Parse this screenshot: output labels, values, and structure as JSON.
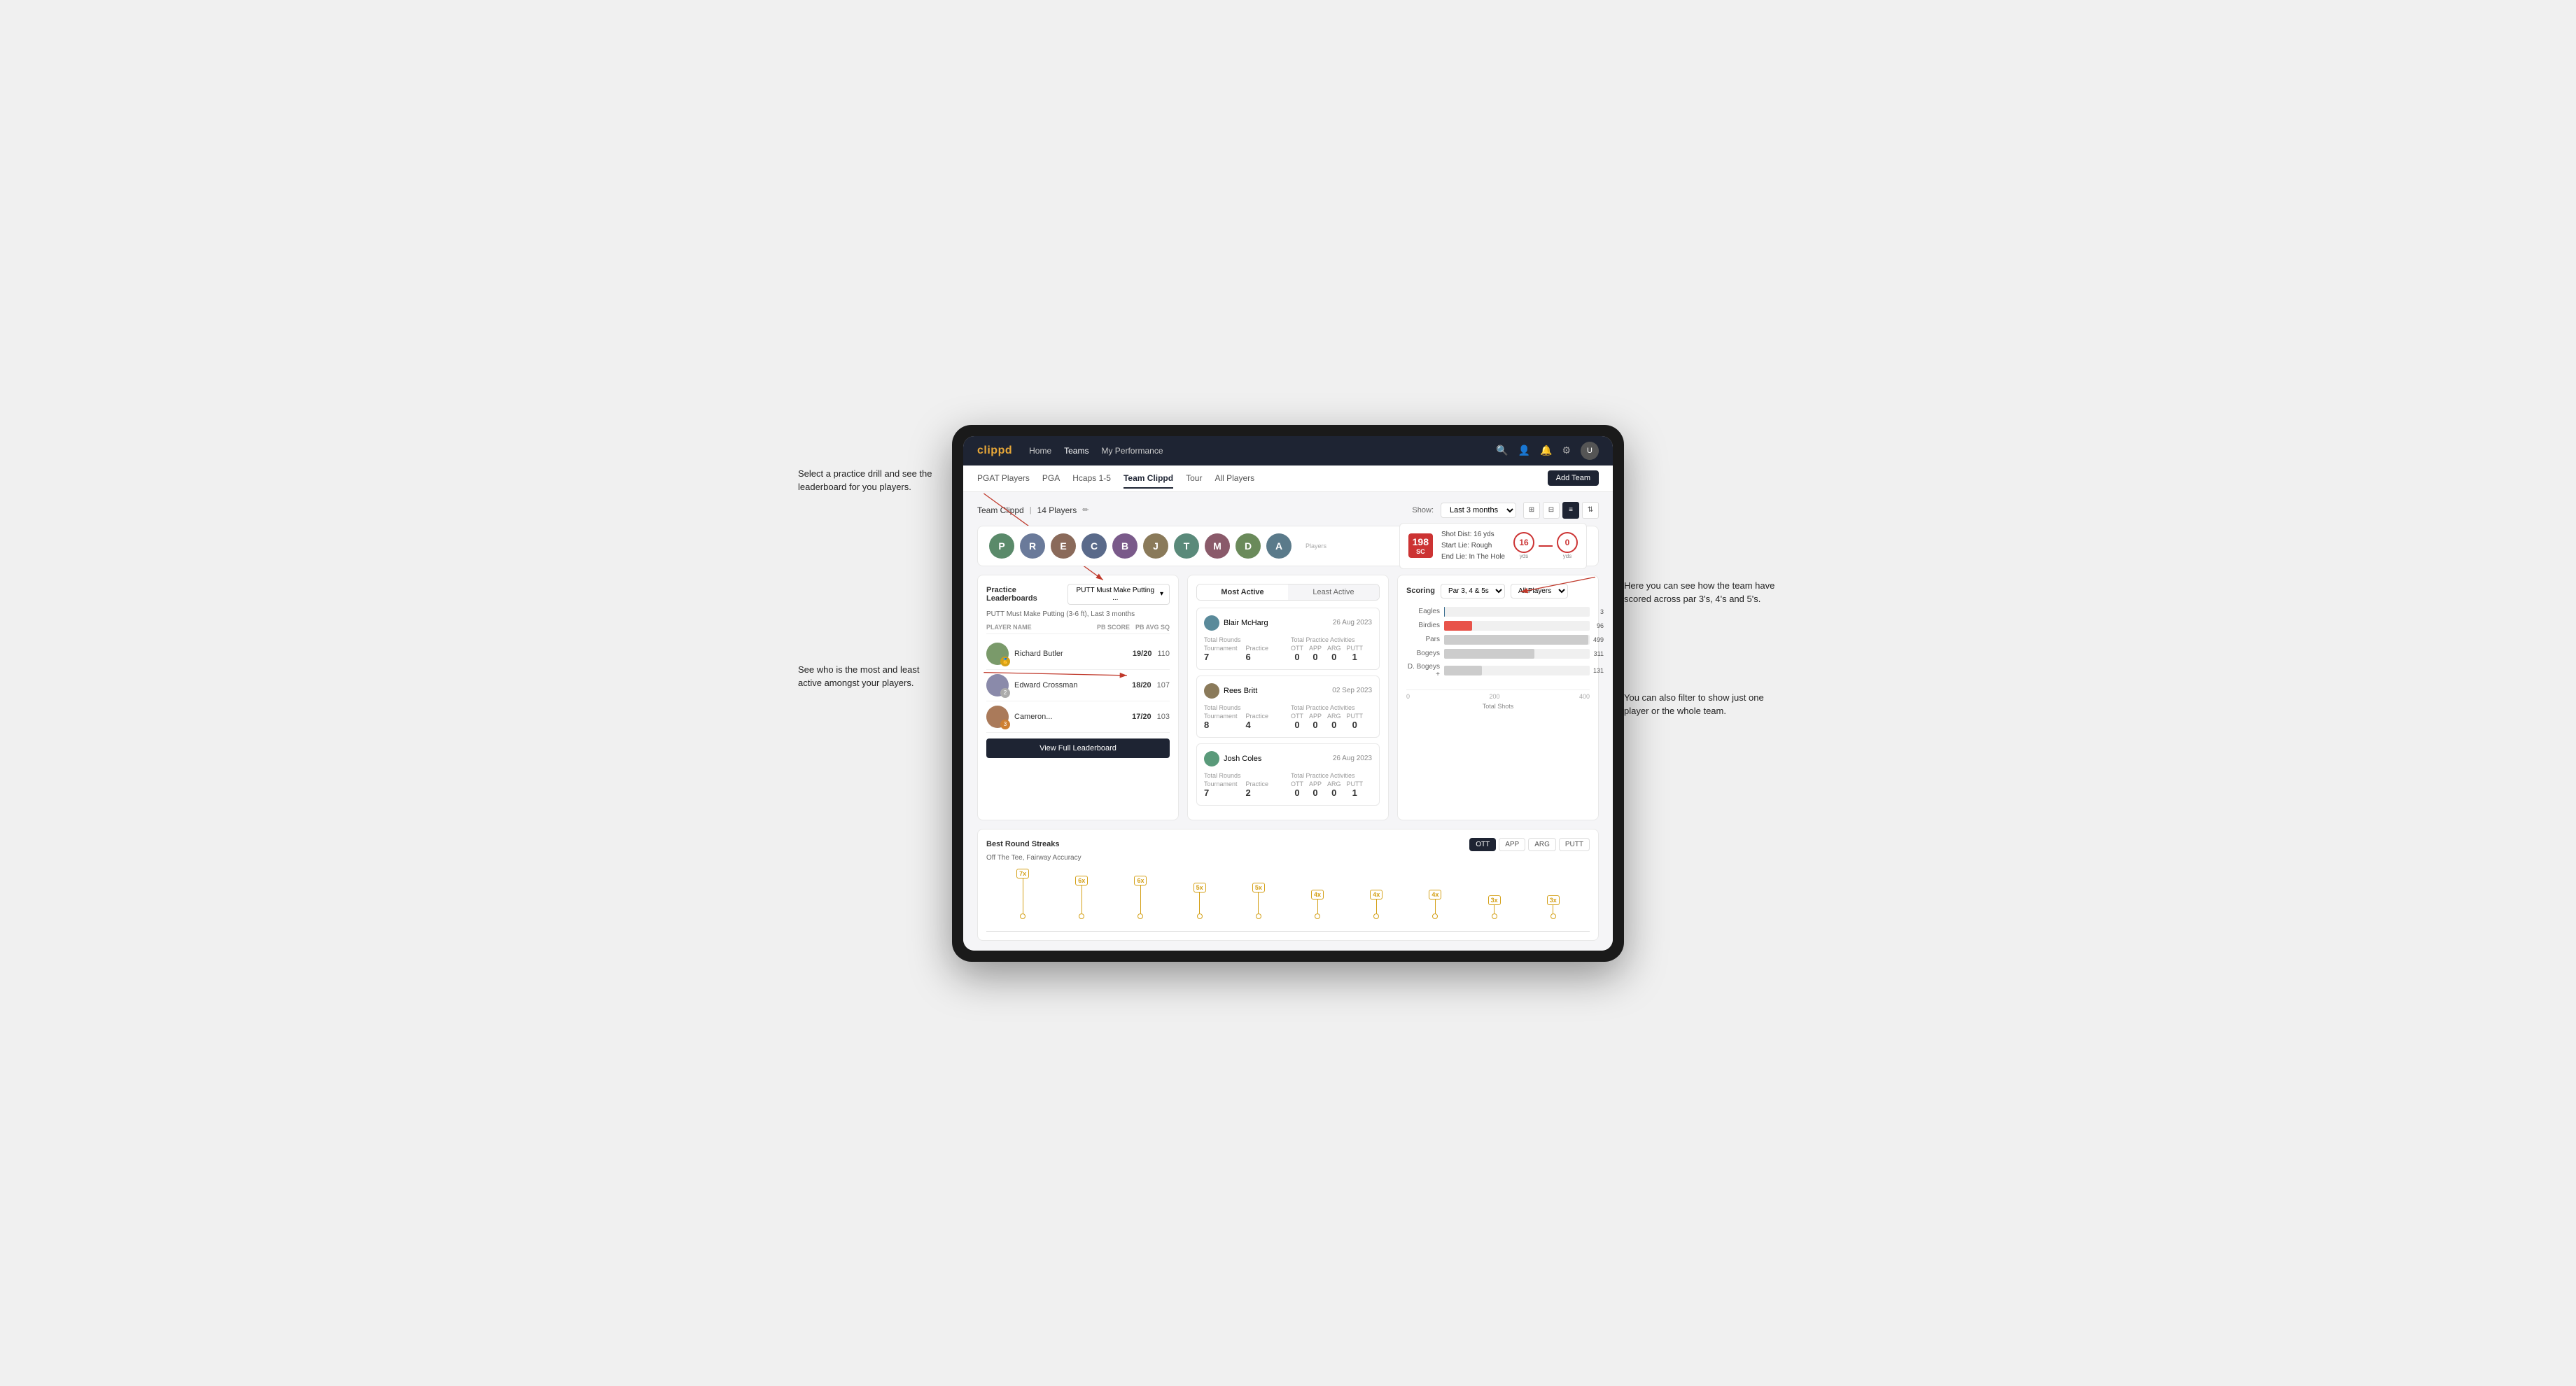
{
  "annotations": {
    "top_left": "Select a practice drill and see the leaderboard for you players.",
    "bottom_left": "See who is the most and least active amongst your players.",
    "top_right": "Here you can see how the team have scored across par 3's, 4's and 5's.",
    "bottom_right": "You can also filter to show just one player or the whole team."
  },
  "nav": {
    "logo": "clippd",
    "links": [
      "Home",
      "Teams",
      "My Performance"
    ],
    "active_link": "Teams"
  },
  "subnav": {
    "links": [
      "PGAT Players",
      "PGA",
      "Hcaps 1-5",
      "Team Clippd",
      "Tour",
      "All Players"
    ],
    "active_link": "Team Clippd",
    "add_team_btn": "Add Team"
  },
  "team": {
    "title": "Team Clippd",
    "player_count": "14 Players",
    "show_label": "Show:",
    "show_value": "Last 3 months",
    "view_options": [
      "grid-small",
      "grid-large",
      "list",
      "filter"
    ]
  },
  "players_label": "Players",
  "shot_info": {
    "badge": "198\nSC",
    "details": {
      "shot_dist": "Shot Dist: 16 yds",
      "start_lie": "Start Lie: Rough",
      "end_lie": "End Lie: In The Hole"
    },
    "start_yds": "16",
    "start_label": "yds",
    "end_yds": "0",
    "end_label": "yds"
  },
  "practice_leaderboards": {
    "title": "Practice Leaderboards",
    "dropdown_label": "PUTT Must Make Putting ...",
    "sub_label": "PUTT Must Make Putting (3-6 ft), Last 3 months",
    "table_headers": {
      "player_name": "PLAYER NAME",
      "pb_score": "PB SCORE",
      "pb_avg_sq": "PB AVG SQ"
    },
    "players": [
      {
        "name": "Richard Butler",
        "score": "19/20",
        "avg": "110",
        "rank_color": "gold",
        "rank_num": ""
      },
      {
        "name": "Edward Crossman",
        "score": "18/20",
        "avg": "107",
        "rank_color": "silver",
        "rank_num": "2"
      },
      {
        "name": "Cameron...",
        "score": "17/20",
        "avg": "103",
        "rank_color": "bronze",
        "rank_num": "3"
      }
    ],
    "view_btn": "View Full Leaderboard"
  },
  "activity": {
    "tabs": [
      "Most Active",
      "Least Active"
    ],
    "active_tab": "Most Active",
    "players": [
      {
        "name": "Blair McHarg",
        "date": "26 Aug 2023",
        "total_rounds_label": "Total Rounds",
        "tournament_label": "Tournament",
        "tournament_val": "7",
        "practice_label": "Practice",
        "practice_val": "6",
        "total_practice_label": "Total Practice Activities",
        "ott_label": "OTT",
        "ott_val": "0",
        "app_label": "APP",
        "app_val": "0",
        "arg_label": "ARG",
        "arg_val": "0",
        "putt_label": "PUTT",
        "putt_val": "1"
      },
      {
        "name": "Rees Britt",
        "date": "02 Sep 2023",
        "total_rounds_label": "Total Rounds",
        "tournament_label": "Tournament",
        "tournament_val": "8",
        "practice_label": "Practice",
        "practice_val": "4",
        "total_practice_label": "Total Practice Activities",
        "ott_label": "OTT",
        "ott_val": "0",
        "app_label": "APP",
        "app_val": "0",
        "arg_label": "ARG",
        "arg_val": "0",
        "putt_label": "PUTT",
        "putt_val": "0"
      },
      {
        "name": "Josh Coles",
        "date": "26 Aug 2023",
        "total_rounds_label": "Total Rounds",
        "tournament_label": "Tournament",
        "tournament_val": "7",
        "practice_label": "Practice",
        "practice_val": "2",
        "total_practice_label": "Total Practice Activities",
        "ott_label": "OTT",
        "ott_val": "0",
        "app_label": "APP",
        "app_val": "0",
        "arg_label": "ARG",
        "arg_val": "0",
        "putt_label": "PUTT",
        "putt_val": "1"
      }
    ]
  },
  "scoring": {
    "title": "Scoring",
    "filter1": "Par 3, 4 & 5s",
    "filter2": "All Players",
    "bars": [
      {
        "label": "Eagles",
        "value": 3,
        "max": 500,
        "color": "#3a6e8f"
      },
      {
        "label": "Birdies",
        "value": 96,
        "max": 500,
        "color": "#e8534a"
      },
      {
        "label": "Pars",
        "value": 499,
        "max": 500,
        "color": "#bbb"
      },
      {
        "label": "Bogeys",
        "value": 311,
        "max": 500,
        "color": "#bbb"
      },
      {
        "label": "D. Bogeys +",
        "value": 131,
        "max": 500,
        "color": "#bbb"
      }
    ],
    "x_labels": [
      "0",
      "200",
      "400"
    ],
    "footer_label": "Total Shots"
  },
  "best_round_streaks": {
    "title": "Best Round Streaks",
    "sub_label": "Off The Tee, Fairway Accuracy",
    "filter_btns": [
      "OTT",
      "APP",
      "ARG",
      "PUTT"
    ],
    "active_filter": "OTT",
    "streak_points": [
      {
        "x_pct": 8,
        "label": "7x",
        "height_pct": 85
      },
      {
        "x_pct": 18,
        "label": "6x",
        "height_pct": 70
      },
      {
        "x_pct": 27,
        "label": "6x",
        "height_pct": 70
      },
      {
        "x_pct": 38,
        "label": "5x",
        "height_pct": 55
      },
      {
        "x_pct": 47,
        "label": "5x",
        "height_pct": 55
      },
      {
        "x_pct": 57,
        "label": "4x",
        "height_pct": 40
      },
      {
        "x_pct": 65,
        "label": "4x",
        "height_pct": 40
      },
      {
        "x_pct": 73,
        "label": "4x",
        "height_pct": 40
      },
      {
        "x_pct": 80,
        "label": "3x",
        "height_pct": 25
      },
      {
        "x_pct": 88,
        "label": "3x",
        "height_pct": 25
      }
    ]
  },
  "player_avatars": [
    {
      "color": "#5a8a6a",
      "initial": "P"
    },
    {
      "color": "#6a7a9a",
      "initial": "R"
    },
    {
      "color": "#8a6a5a",
      "initial": "E"
    },
    {
      "color": "#5a6a8a",
      "initial": "C"
    },
    {
      "color": "#7a5a8a",
      "initial": "B"
    },
    {
      "color": "#8a7a5a",
      "initial": "J"
    },
    {
      "color": "#5a8a7a",
      "initial": "T"
    },
    {
      "color": "#8a5a6a",
      "initial": "M"
    },
    {
      "color": "#6a8a5a",
      "initial": "D"
    },
    {
      "color": "#5a7a8a",
      "initial": "A"
    }
  ]
}
